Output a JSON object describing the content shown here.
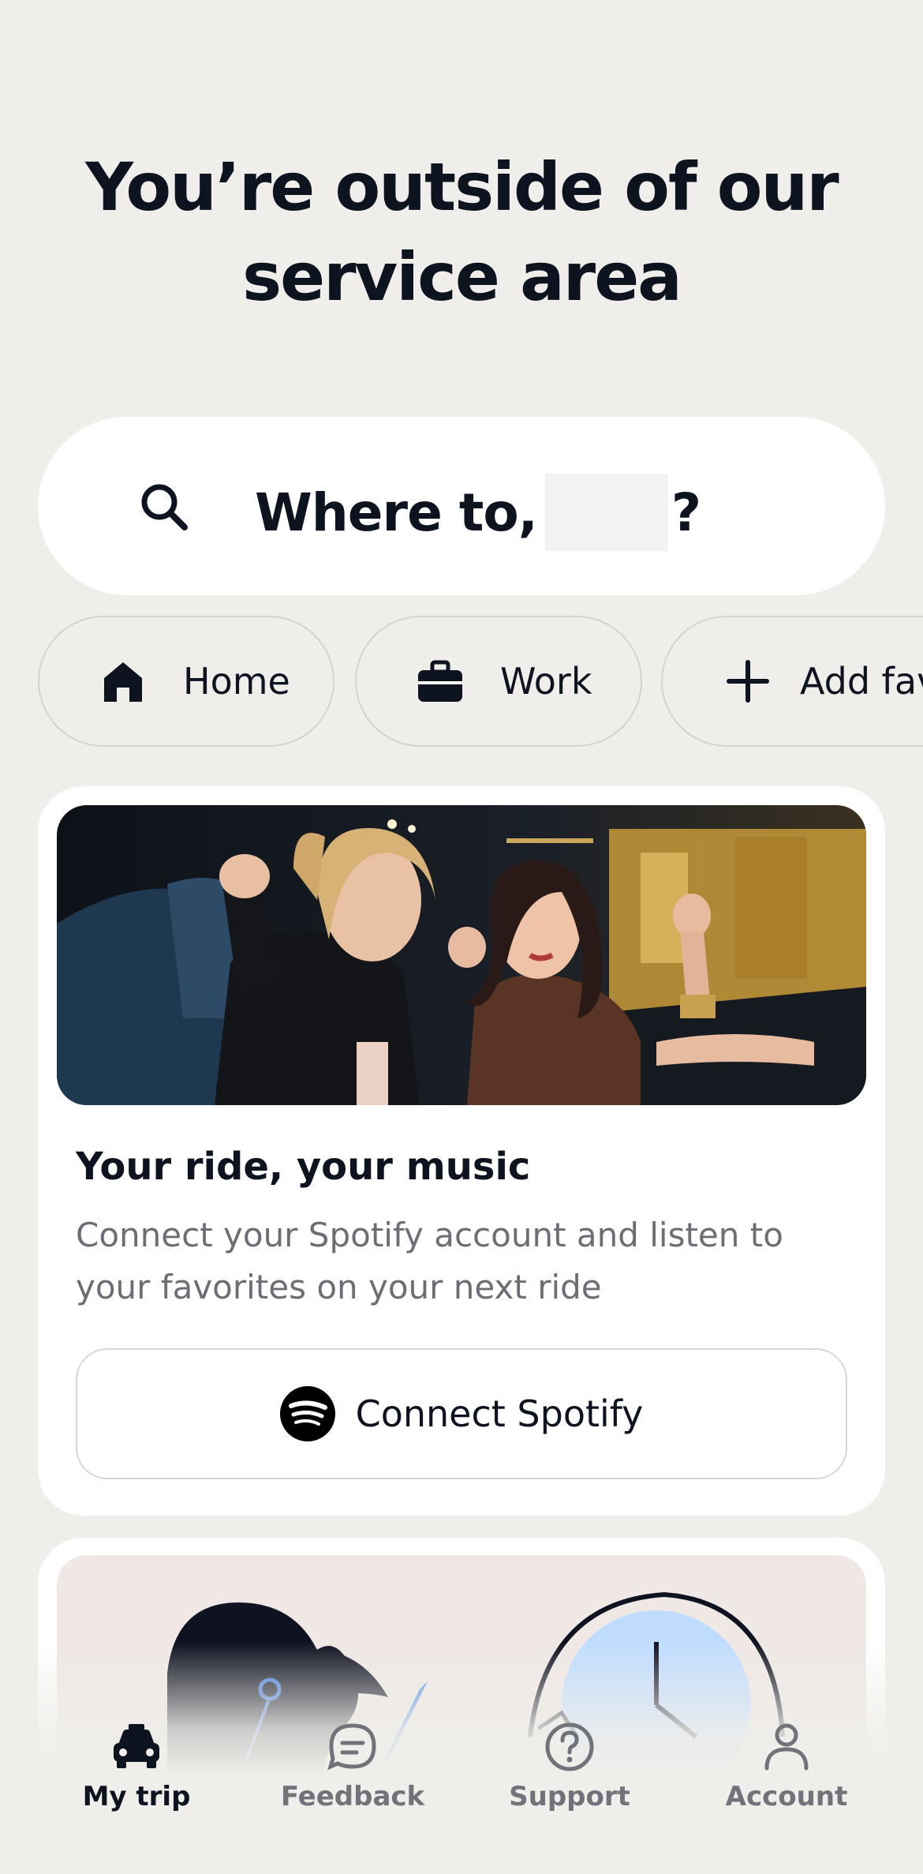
{
  "headline": {
    "line1": "You’re outside of our",
    "line2": "service area"
  },
  "search": {
    "prefix": "Where to,",
    "suffix": "?",
    "icon": "search-icon"
  },
  "chips": [
    {
      "label": "Home",
      "icon": "home-icon"
    },
    {
      "label": "Work",
      "icon": "briefcase-icon"
    },
    {
      "label": "Add fav",
      "icon": "plus-icon"
    }
  ],
  "promo": {
    "title": "Your ride, your music",
    "description": "Connect your Spotify account and listen to your favorites on your next ride",
    "button_label": "Connect Spotify",
    "button_icon": "spotify-icon"
  },
  "tabs": [
    {
      "label": "My trip",
      "icon": "car-icon",
      "active": true
    },
    {
      "label": "Feedback",
      "icon": "chat-icon",
      "active": false
    },
    {
      "label": "Support",
      "icon": "help-icon",
      "active": false
    },
    {
      "label": "Account",
      "icon": "person-icon",
      "active": false
    }
  ],
  "colors": {
    "background": "#efeeea",
    "text": "#0e1320",
    "muted": "#6c6e75"
  }
}
